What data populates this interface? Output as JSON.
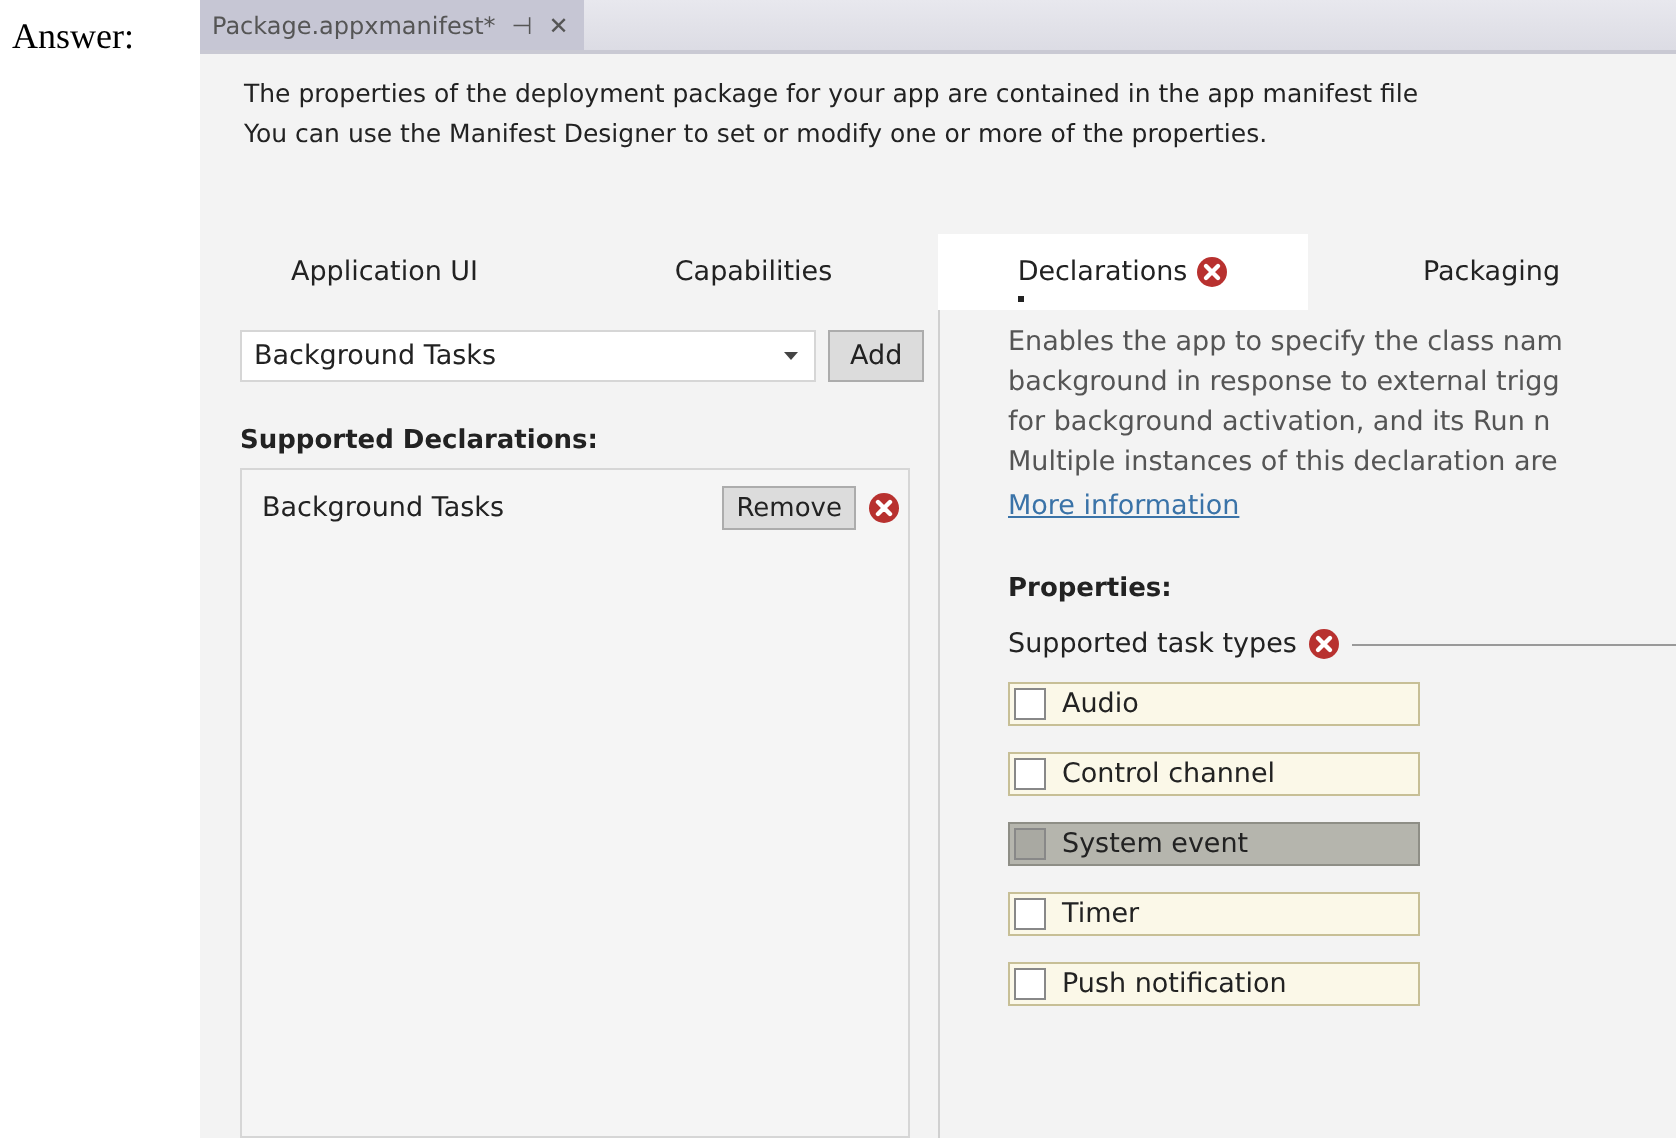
{
  "label": "Answer:",
  "document_tab": {
    "title": "Package.appxmanifest*",
    "pin": "⊣",
    "close": "✕"
  },
  "intro": [
    "The properties of the deployment package for your app are contained in the app manifest file",
    "You can use the Manifest Designer to set or modify one or more of the properties."
  ],
  "tabs": [
    {
      "label": "Application UI",
      "selected": false,
      "error": false
    },
    {
      "label": "Capabilities",
      "selected": false,
      "error": false
    },
    {
      "label": "Declarations",
      "selected": true,
      "error": true
    },
    {
      "label": "Packaging",
      "selected": false,
      "error": false
    }
  ],
  "available_declarations": {
    "value": "Background Tasks",
    "add_button": "Add"
  },
  "supported_declarations": {
    "heading": "Supported Declarations:",
    "items": [
      {
        "label": "Background Tasks",
        "remove_button": "Remove",
        "error": true
      }
    ]
  },
  "description": [
    "Enables the app to specify the class nam",
    "background in response to external trigg",
    "for background activation, and its Run n",
    "Multiple instances of this declaration are"
  ],
  "more_info_link": "More information",
  "properties": {
    "heading": "Properties:",
    "group_label": "Supported task types",
    "group_error": true,
    "task_types": [
      {
        "label": "Audio",
        "checked": false,
        "highlighted": false
      },
      {
        "label": "Control channel",
        "checked": false,
        "highlighted": false
      },
      {
        "label": "System event",
        "checked": false,
        "highlighted": true
      },
      {
        "label": "Timer",
        "checked": false,
        "highlighted": false
      },
      {
        "label": "Push notification",
        "checked": false,
        "highlighted": false
      }
    ]
  }
}
